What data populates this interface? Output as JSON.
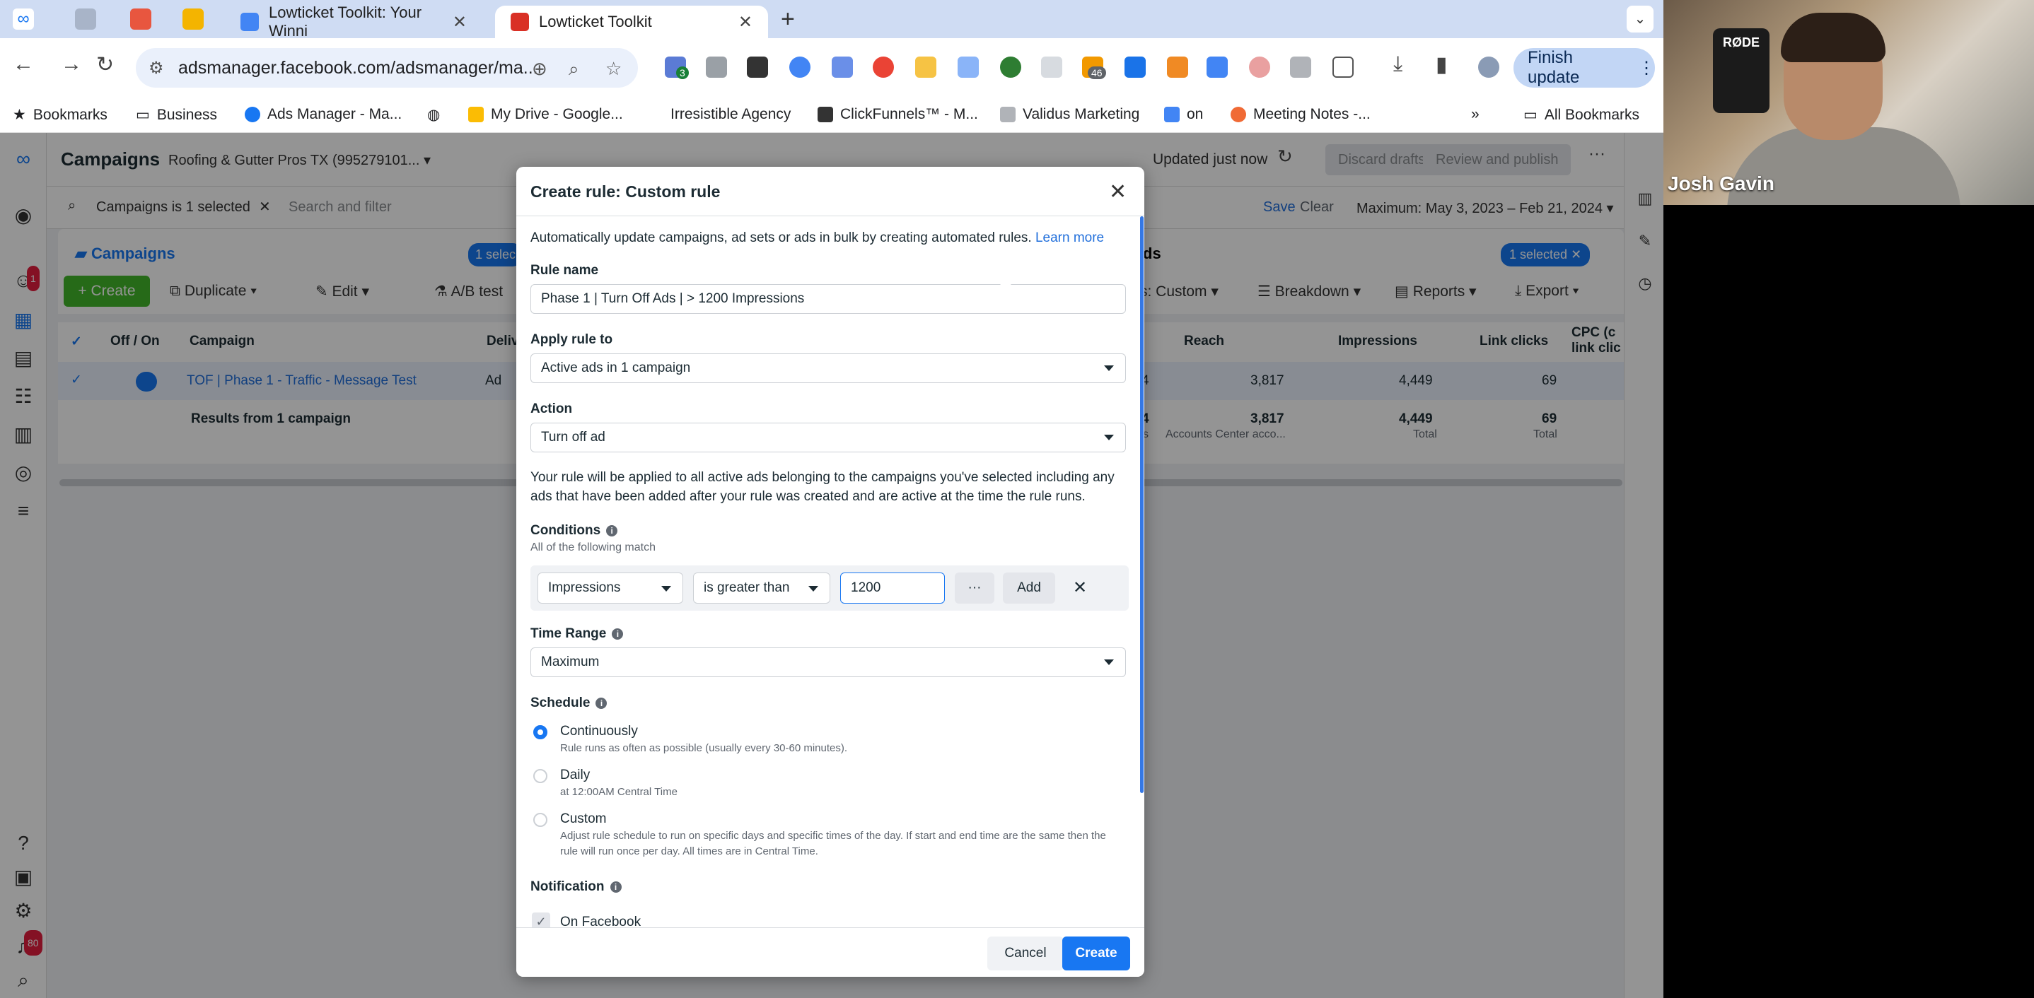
{
  "browser": {
    "tabs": [
      {
        "title": "Lowticket Toolkit: Your Winni",
        "color": "#4285f4"
      },
      {
        "title": "Lowticket Toolkit",
        "color": "#d93025"
      }
    ],
    "url": "adsmanager.facebook.com/adsmanager/ma...",
    "ext_badge_1": "3",
    "ext_badge_2": "46",
    "finish_update": "Finish update",
    "bookmarks": [
      "Bookmarks",
      "Business",
      "Ads Manager - Ma...",
      "My Drive - Google...",
      "Irresistible Agency",
      "ClickFunnels™ - M...",
      "Validus Marketing",
      "on",
      "Meeting Notes -...",
      "All Bookmarks"
    ]
  },
  "app": {
    "title": "Campaigns",
    "account": "Roofing & Gutter Pros TX (995279101...",
    "updated": "Updated just now",
    "discard": "Discard drafts",
    "review": "Review and publish",
    "filter_chip": "Campaigns is 1 selected",
    "search_placeholder": "Search and filter",
    "save": "Save",
    "clear": "Clear",
    "date_range": "Maximum: May 3, 2023 – Feb 21, 2024",
    "campaigns_tab": "Campaigns",
    "selected_chip_left": "1 selec",
    "ads_tab": "ds",
    "selected_chip_right": "1 selected",
    "notif_badge_top": "1",
    "notif_badge_bottom": "80",
    "actions": {
      "create": "+ Create",
      "duplicate": "Duplicate",
      "edit": "Edit",
      "ab_test": "A/B test",
      "columns": "s: Custom",
      "breakdown": "Breakdown",
      "reports": "Reports",
      "export": "Export"
    },
    "table": {
      "headers": {
        "off_on": "Off / On",
        "campaign": "Campaign",
        "delivery": "Deliv",
        "reach": "Reach",
        "impressions": "Impressions",
        "link_clicks": "Link clicks",
        "cpc": "CPC (c",
        "cpc2": "link clic"
      },
      "row": {
        "name": "TOF | Phase 1 - Traffic - Message Test",
        "delivery": "Ad",
        "reach_prefix": "4",
        "reach": "3,817",
        "impressions": "4,449",
        "link_clicks": "69"
      },
      "totals": {
        "label": "Results from 1 campaign",
        "reach_prefix": "4",
        "reach_prefix_sub": "s",
        "reach": "3,817",
        "reach_sub": "Accounts Center acco...",
        "impressions": "4,449",
        "impressions_sub": "Total",
        "link_clicks": "69",
        "link_clicks_sub": "Total"
      }
    }
  },
  "modal": {
    "title": "Create rule: Custom rule",
    "intro": "Automatically update campaigns, ad sets or ads in bulk by creating automated rules.",
    "learn_more": "Learn more",
    "rule_name_label": "Rule name",
    "rule_name_value": "Phase 1 | Turn Off Ads | > 1200 Impressions",
    "apply_label": "Apply rule to",
    "apply_value": "Active ads in 1 campaign",
    "action_label": "Action",
    "action_value": "Turn off ad",
    "apply_note": "Your rule will be applied to all active ads belonging to the campaigns you've selected including any ads that have been added after your rule was created and are active at the time the rule runs.",
    "conditions_label": "Conditions",
    "conditions_hint": "All of the following match",
    "condition": {
      "metric": "Impressions",
      "operator": "is greater than",
      "value": "1200",
      "more": "···",
      "add": "Add"
    },
    "time_range_label": "Time Range",
    "time_range_value": "Maximum",
    "schedule_label": "Schedule",
    "schedule": [
      {
        "label": "Continuously",
        "desc": "Rule runs as often as possible (usually every 30-60 minutes).",
        "selected": true
      },
      {
        "label": "Daily",
        "desc": "at 12:00AM Central Time",
        "selected": false
      },
      {
        "label": "Custom",
        "desc": "Adjust rule schedule to run on specific days and specific times of the day. If start and end time are the same then the rule will run once per day. All times are in Central Time.",
        "selected": false
      }
    ],
    "notification_label": "Notification",
    "notification_option": "On Facebook",
    "cancel": "Cancel",
    "create": "Create"
  },
  "webcam": {
    "name": "Josh Gavin",
    "brand": "RØDE"
  }
}
